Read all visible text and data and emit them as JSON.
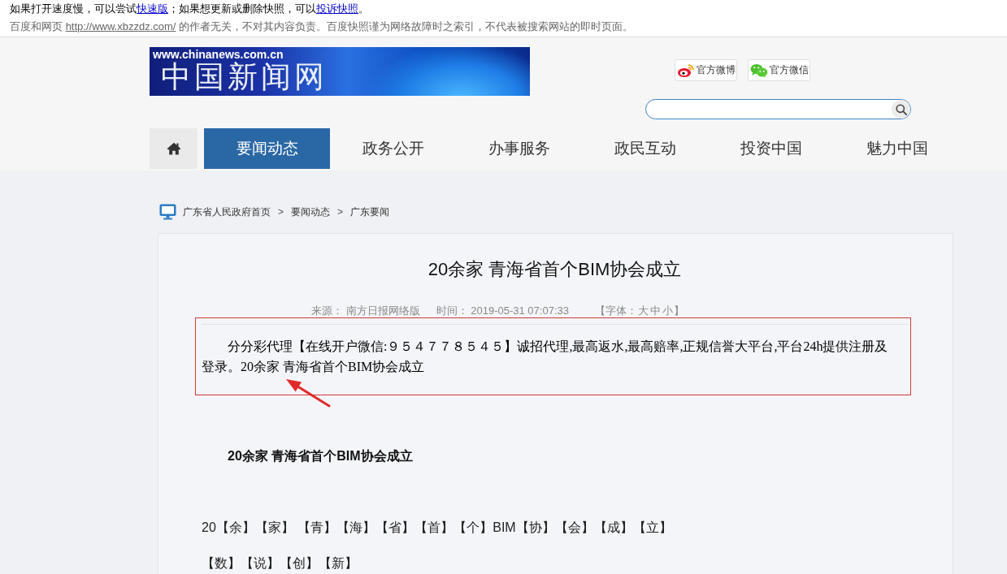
{
  "snapshot_notice": {
    "lines": [
      {
        "parts": [
          {
            "kind": "text",
            "text": "如果打开速度慢，可以尝试"
          },
          {
            "kind": "link",
            "text": "快速版"
          },
          {
            "kind": "text",
            "text": "；如果想更新或删除快照，可以"
          },
          {
            "kind": "link",
            "text": "投诉快照"
          },
          {
            "kind": "text",
            "text": "。"
          }
        ]
      },
      {
        "parts": [
          {
            "kind": "text",
            "text": "百度和网页 "
          },
          {
            "kind": "link",
            "text": "http://www.xbzzdz.com/"
          },
          {
            "kind": "text",
            "text": " 的作者无关，不对其内容负责。百度快照谨为网络故障时之索引，不代表被搜索网站的即时页面。"
          }
        ]
      }
    ]
  },
  "logo": {
    "domain": "www.chinanews.com.cn",
    "title": "中国新闻网"
  },
  "social_links": [
    {
      "kind": "weibo",
      "label": "官方微博"
    },
    {
      "kind": "wechat",
      "label": "官方微信"
    }
  ],
  "nav": {
    "items": [
      {
        "label": "要闻动态",
        "selected": true
      },
      {
        "label": "政务公开",
        "selected": false
      },
      {
        "label": "办事服务",
        "selected": false
      },
      {
        "label": "政民互动",
        "selected": false
      },
      {
        "label": "投资中国",
        "selected": false
      },
      {
        "label": "魅力中国",
        "selected": false
      }
    ]
  },
  "breadcrumb": [
    {
      "kind": "link",
      "text": "广东省人民政府首页"
    },
    {
      "kind": "separator",
      "text": ">"
    },
    {
      "kind": "link",
      "text": "要闻动态"
    },
    {
      "kind": "separator",
      "text": ">"
    },
    {
      "kind": "link",
      "text": "广东要闻"
    }
  ],
  "article": {
    "title": "20余家 青海省首个BIM协会成立",
    "source": "来源： 南方日报网络版",
    "time": "时间： 2019-05-31 07:07:33",
    "font_size": {
      "open": "【字体：",
      "options": [
        "大",
        "中",
        "小"
      ],
      "close": "】"
    },
    "highlighted_paragraph": "分分彩代理【在线开户微信:９５４７７８５４５】诚招代理,最高返水,最高赔率,正规信誉大平台,平台24h提供注册及登录。20余家 青海省首个BIM协会成立",
    "subheading": "20余家 青海省首个BIM协会成立",
    "tag_lines": [
      "20【余】【家】 【青】【海】【省】【首】【个】BIM【协】【会】【成】【立】",
      "【数】【说】【创】【新】"
    ]
  }
}
